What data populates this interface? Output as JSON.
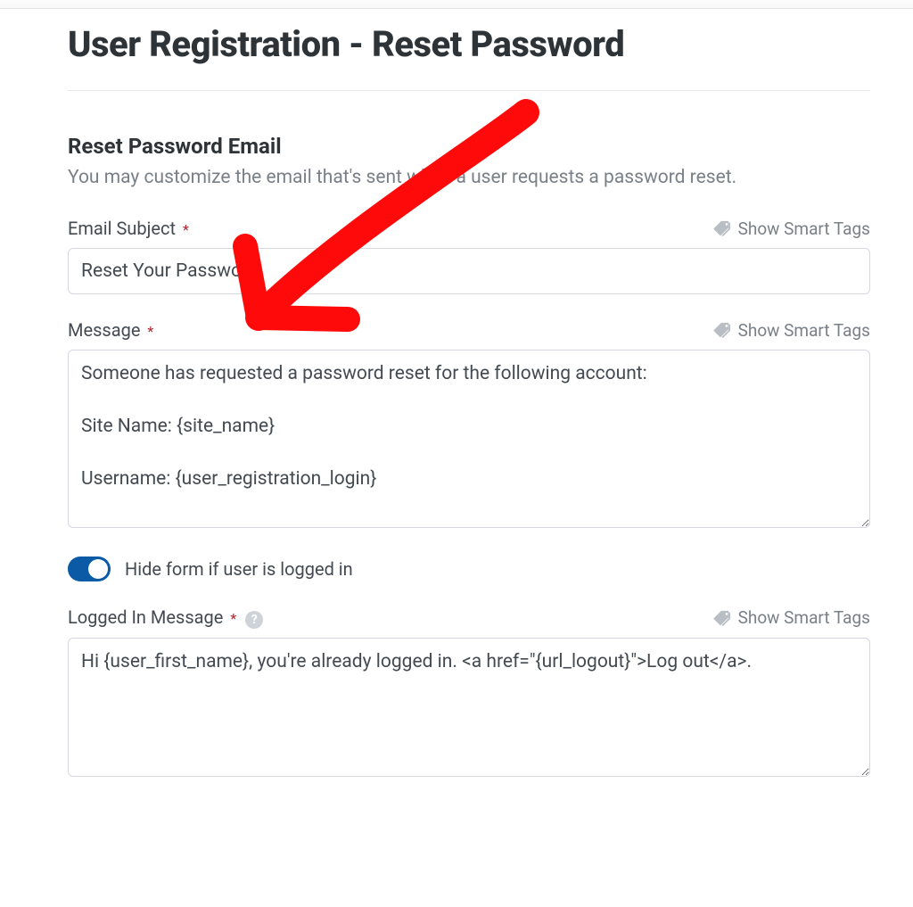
{
  "page": {
    "title": "User Registration - Reset Password"
  },
  "section": {
    "title": "Reset Password Email",
    "desc": "You may customize the email that's sent when a user requests a password reset."
  },
  "smartTagsLabel": "Show Smart Tags",
  "fields": {
    "emailSubject": {
      "label": "Email Subject",
      "value": "Reset Your Password"
    },
    "message": {
      "label": "Message",
      "value": "Someone has requested a password reset for the following account:\n\nSite Name: {site_name}\n\nUsername: {user_registration_login}"
    },
    "hideForm": {
      "label": "Hide form if user is logged in",
      "on": true
    },
    "loggedInMessage": {
      "label": "Logged In Message",
      "value": "Hi {user_first_name}, you're already logged in. <a href=\"{url_logout}\">Log out</a>."
    }
  }
}
